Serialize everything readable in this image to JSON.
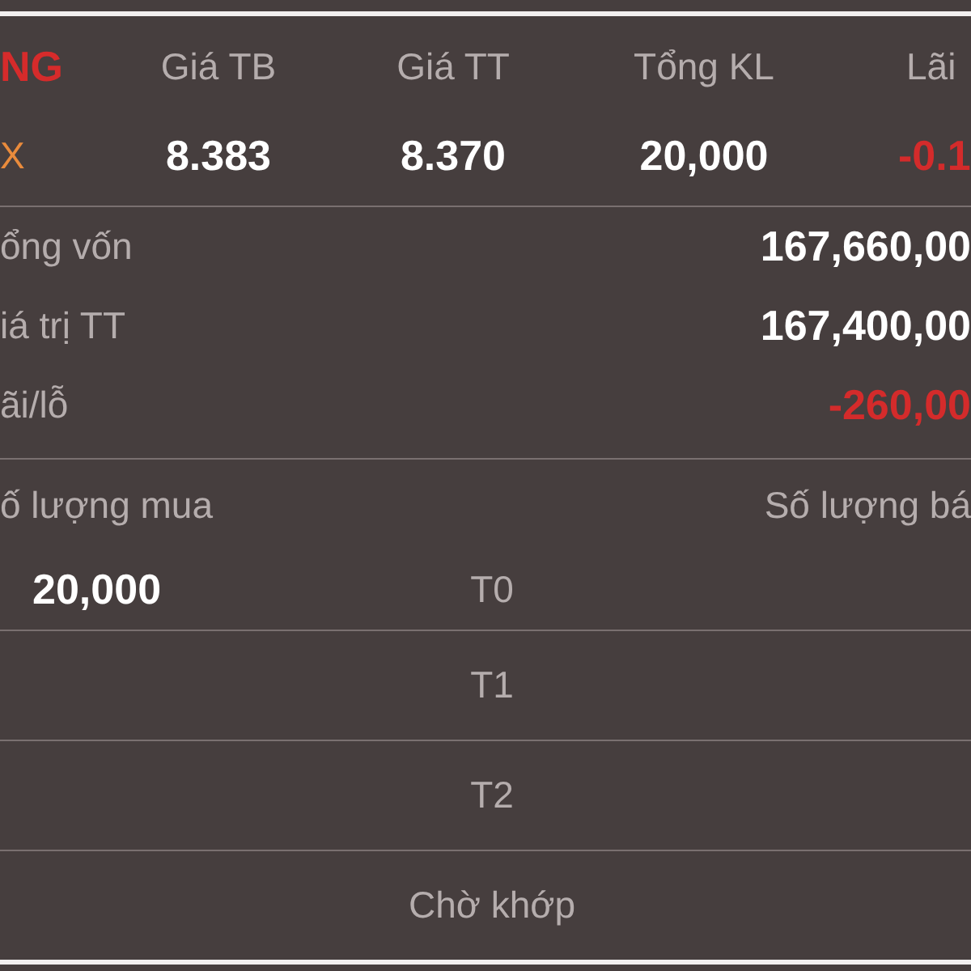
{
  "columns": [
    {
      "label": "NG",
      "kind": "title"
    },
    {
      "label": "Giá TB",
      "kind": "label"
    },
    {
      "label": "Giá TT",
      "kind": "label"
    },
    {
      "label": "Tổng KL",
      "kind": "label"
    },
    {
      "label": "Lãi",
      "kind": "label"
    }
  ],
  "holding": [
    {
      "value": "X",
      "kind": "symbol"
    },
    {
      "value": "8.383",
      "kind": "value"
    },
    {
      "value": "8.370",
      "kind": "value"
    },
    {
      "value": "20,000",
      "kind": "value"
    },
    {
      "value": "-0.1",
      "kind": "loss"
    }
  ],
  "summary": [
    {
      "label": "ổng vốn",
      "value": "167,660,00",
      "kind": "value"
    },
    {
      "label": "iá trị TT",
      "value": "167,400,00",
      "kind": "value"
    },
    {
      "label": "ãi/lỗ",
      "value": "-260,00",
      "kind": "loss"
    }
  ],
  "quantities": {
    "buy_label": "ố lượng mua",
    "sell_label": "Số lượng bá",
    "rows": [
      {
        "buy": "20,000",
        "period": "T0"
      },
      {
        "buy": "",
        "period": "T1"
      },
      {
        "buy": "",
        "period": "T2"
      },
      {
        "buy": "",
        "period": "Chờ khớp"
      }
    ]
  }
}
